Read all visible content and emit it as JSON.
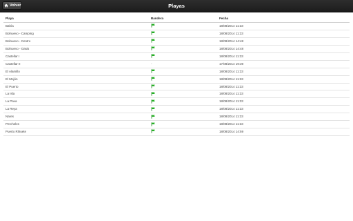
{
  "header": {
    "back_label": "Volver",
    "title": "Playas"
  },
  "table": {
    "columns": [
      "Playa",
      "Bandera",
      "Fecha"
    ],
    "rows": [
      {
        "playa": "Bahía",
        "bandera": "green-flag",
        "fecha": "18/08/2014 11:33"
      },
      {
        "playa": "Bolnuevo - Camping",
        "bandera": "green-flag",
        "fecha": "18/08/2014 11:33"
      },
      {
        "playa": "Bolnuevo - Centro",
        "bandera": "green-flag",
        "fecha": "18/08/2014 14:48"
      },
      {
        "playa": "Bolnuevo - Oasis",
        "bandera": "green-flag",
        "fecha": "18/08/2014 14:48"
      },
      {
        "playa": "Castellar I",
        "bandera": "green-flag",
        "fecha": "18/08/2014 11:33"
      },
      {
        "playa": "Castellar II",
        "bandera": "-",
        "fecha": "17/08/2014 19:39"
      },
      {
        "playa": "El Alamillo",
        "bandera": "green-flag",
        "fecha": "18/08/2014 11:33"
      },
      {
        "playa": "El Mojón",
        "bandera": "green-flag",
        "fecha": "18/08/2014 11:33"
      },
      {
        "playa": "El Puerto",
        "bandera": "green-flag",
        "fecha": "18/08/2014 11:33"
      },
      {
        "playa": "La Isla",
        "bandera": "green-flag",
        "fecha": "18/08/2014 11:33"
      },
      {
        "playa": "La Pava",
        "bandera": "green-flag",
        "fecha": "18/08/2014 11:33"
      },
      {
        "playa": "La Reya",
        "bandera": "green-flag",
        "fecha": "18/08/2014 11:33"
      },
      {
        "playa": "Nares",
        "bandera": "green-flag",
        "fecha": "18/08/2014 11:33"
      },
      {
        "playa": "Percheles",
        "bandera": "green-flag",
        "fecha": "18/08/2014 11:33"
      },
      {
        "playa": "Puerto Rihuete",
        "bandera": "green-flag",
        "fecha": "18/08/2014 14:59"
      }
    ]
  },
  "colors": {
    "topbar": "#1f1f1f",
    "flag_green": "#22b022",
    "row_divider": "#e3e3e3"
  }
}
